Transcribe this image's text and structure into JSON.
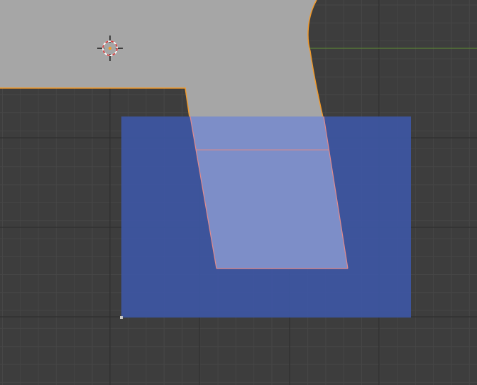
{
  "viewport": {
    "editor": "3d-viewport",
    "view": "top-orthographic",
    "grid": true,
    "colors": {
      "background": "#3d3d3d",
      "grid_minor": "#464646",
      "grid_major": "#2f2f2f",
      "x_axis": "#5a7f35",
      "mesh_fill": "#a6a6a6",
      "mesh_outline": "#f19a2c",
      "face_selected": "#9aa7d8",
      "face_selected_edge": "#e38a8a",
      "box_select": "#3d56a3",
      "cursor_red": "#d43d3d",
      "cursor_white": "#ffffff"
    }
  },
  "scene": {
    "cursor": {
      "icon": "3d-cursor-icon"
    },
    "object": {
      "mode": "edit",
      "selected_faces": 2
    },
    "box_select": {
      "active": true
    }
  }
}
